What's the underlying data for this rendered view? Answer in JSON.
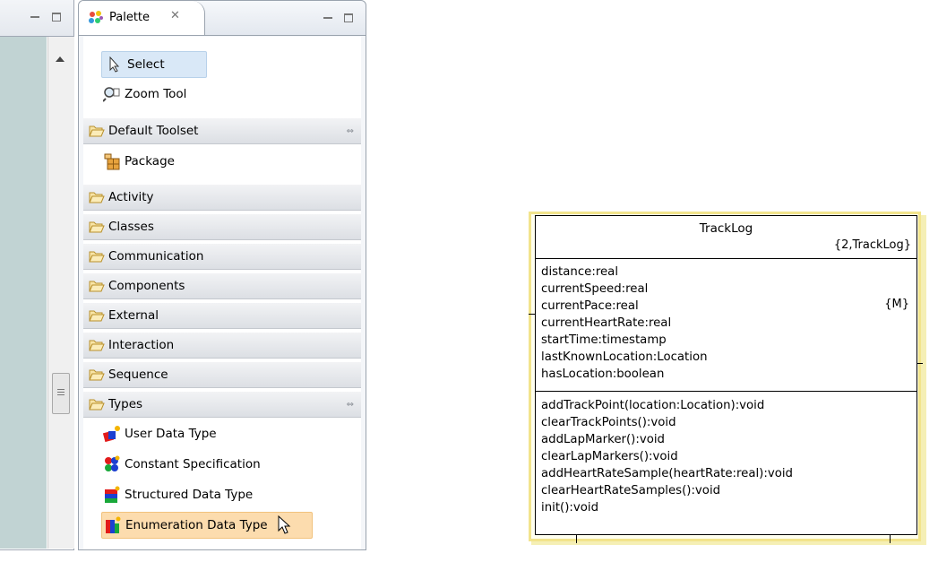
{
  "palette": {
    "tab_label": "Palette",
    "tools": [
      {
        "label": "Select",
        "icon": "arrow-pointer-icon"
      },
      {
        "label": "Zoom Tool",
        "icon": "magnifier-icon"
      }
    ],
    "drawers": [
      {
        "label": "Default Toolset",
        "expanded": true
      },
      {
        "label": "Activity"
      },
      {
        "label": "Classes"
      },
      {
        "label": "Communication"
      },
      {
        "label": "Components"
      },
      {
        "label": "External"
      },
      {
        "label": "Interaction"
      },
      {
        "label": "Sequence"
      },
      {
        "label": "Types",
        "expanded": true
      }
    ],
    "default_toolset_items": [
      {
        "label": "Package",
        "icon": "package-icon"
      }
    ],
    "types_items": [
      {
        "label": "User Data Type",
        "icon": "user-data-type-icon"
      },
      {
        "label": "Constant Specification",
        "icon": "constant-specification-icon"
      },
      {
        "label": "Structured Data Type",
        "icon": "structured-data-type-icon"
      },
      {
        "label": "Enumeration Data Type",
        "icon": "enumeration-data-type-icon"
      }
    ]
  },
  "uml_class": {
    "name": "TrackLog",
    "key_letters": "{2,TrackLog}",
    "attributes": [
      "distance:real",
      "currentSpeed:real",
      "currentPace:real",
      "currentHeartRate:real",
      "startTime:timestamp",
      "lastKnownLocation:Location",
      "hasLocation:boolean"
    ],
    "attribute_marker": "{M}",
    "operations": [
      "addTrackPoint(location:Location):void",
      "clearTrackPoints():void",
      "addLapMarker():void",
      "clearLapMarkers():void",
      "addHeartRateSample(heartRate:real):void",
      "clearHeartRateSamples():void",
      "init():void"
    ]
  },
  "colors": {
    "selected_tool_bg": "#cfe3f7",
    "hover_item_bg": "#fbd9a8",
    "editor_canvas": "#c1d3d3",
    "uml_border": "#f2e48c"
  }
}
